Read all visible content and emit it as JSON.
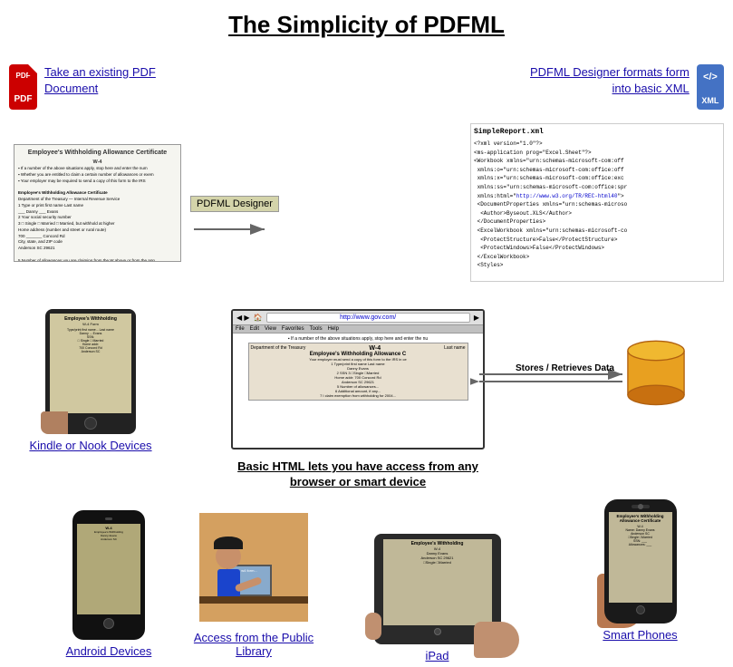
{
  "title": "The Simplicity of PDFML",
  "top_section": {
    "pdf_icon_label": "Take an existing PDF Document",
    "xml_block_label": "PDFML Designer formats form into basic XML",
    "arrow_label": "PDFML Designer",
    "xml_code": "<?xml version=\"1.0\"?>\n<ms-application prog=\"Excel.Sheet\"?>\n<Workbook xmlns=\"urn:schemas-microsoft-com:of\n xmlns:o=\"urn:schemas-microsoft-com:office:of\n xmlns:x=\"urn:schemas-microsoft-com:office:ex\n xmlns:ss=\"urn:schemas-microsoft-com:office:sp\n xmlns:html=\"http://www.w3.org/TR/REC-html40\">\n <DocumentProperties xmlns=\"urn:schemas-micro\n  <Author>Byseout.XLS</Author>\n </DocumentProperties>\n <ExcelWorkbook xmlns=\"urn:schemas-microsoft-c\n  <ProtectStructure>False</ProtectStructure>\n  <ProtectWindows>False</ProtectWindows>\n </ExcelWorkbook>\n <Styles>"
  },
  "middle_section": {
    "browser_url": "http://www.gov.com/",
    "browser_menu": [
      "File",
      "Edit",
      "View",
      "Favorites",
      "Tools",
      "Help"
    ],
    "form_title": "Employee's Withholding Allowance C",
    "form_subtitle": "W-4",
    "html_label": "Basic HTML lets you have access from any browser or smart device",
    "kindle_label": "Kindle or Nook Devices",
    "stores_label": "Stores / Retrieves Data"
  },
  "bottom_section": {
    "android_label": "Android Devices",
    "library_label": "Access from the Public Library",
    "ipad_label": "iPad",
    "smartphone_label": "Smart Phones",
    "access_text": "Access from the"
  }
}
